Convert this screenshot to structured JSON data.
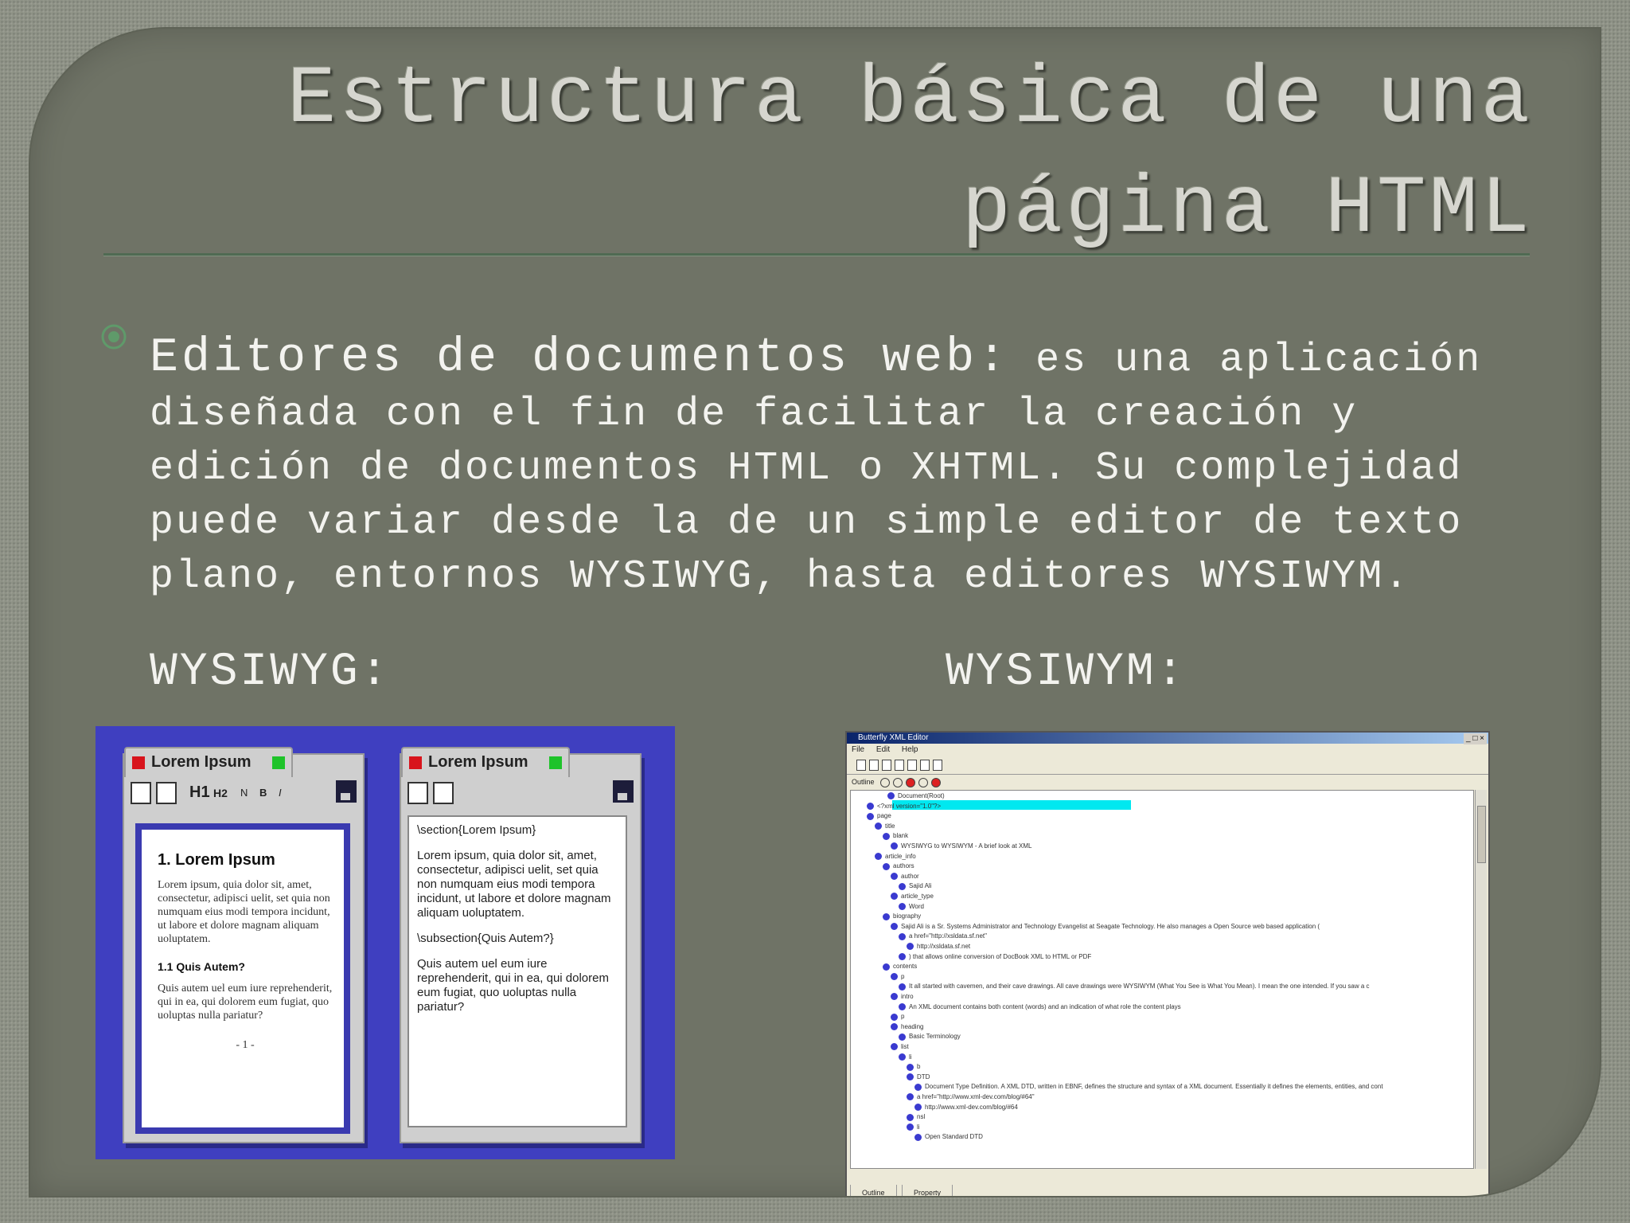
{
  "slide": {
    "title_line1": "Estructura básica de una",
    "title_line2": "página HTML",
    "body_lead": "Editores de documentos web:",
    "body_rest": " es una aplicación diseñada con el fin de facilitar la creación y edición de documentos HTML o XHTML. Su complejidad puede variar desde la de un simple editor de texto plano, entornos WYSIWYG, hasta editores WYSIWYM.",
    "label_wysiwyg": "WYSIWYG:",
    "label_wysiwym": "WYSIWYM:"
  },
  "wysiwyg_image": {
    "left_window": {
      "tab_title": "Lorem Ipsum",
      "toolbar": [
        "H1",
        "H2",
        "N",
        "B",
        "I"
      ],
      "heading": "1. Lorem Ipsum",
      "para1": "Lorem ipsum, quia dolor sit, amet, consectetur, adipisci uelit, set quia non numquam eius modi tempora incidunt, ut labore et dolore magnam aliquam uoluptatem.",
      "subheading": "1.1 Quis Autem?",
      "para2": "Quis autem uel eum iure reprehenderit, qui in ea, qui dolorem eum fugiat, quo uoluptas nulla pariatur?",
      "page_number": "- 1 -"
    },
    "right_window": {
      "tab_title": "Lorem Ipsum",
      "line1": "\\section{Lorem Ipsum}",
      "para1": "Lorem ipsum, quia dolor sit, amet, consectetur, adipisci uelit, set quia non numquam eius modi tempora incidunt, ut labore et dolore magnam aliquam uoluptatem.",
      "line2": "\\subsection{Quis Autem?}",
      "para2": "Quis autem uel eum iure reprehenderit, qui in ea, qui dolorem eum fugiat, quo uoluptas nulla pariatur?"
    }
  },
  "wysiwym_image": {
    "window_title": "Butterfly XML Editor",
    "window_controls": "_ □ ×",
    "menu": [
      "File",
      "Edit",
      "Help"
    ],
    "outline_label": "Outline",
    "tree_nodes": [
      "Document(Root)",
      "<?xml version=\"1.0\"?>",
      "page",
      "title",
      "blank",
      "WYSIWYG to WYSIWYM - A brief look at XML",
      "article_info",
      "authors",
      "author",
      "Sajid Ali",
      "article_type",
      "Word",
      "biography",
      "Sajid Ali is a Sr. Systems Administrator and Technology Evangelist at Seagate Technology. He also manages a Open Source web based application (",
      "a href=\"http://xsldata.sf.net\"",
      "http://xsldata.sf.net",
      ") that allows online conversion of DocBook XML to HTML or PDF",
      "contents",
      "p",
      "It all started with cavemen, and their cave drawings. All cave drawings were WYSIWYM (What You See is What You Mean). I mean the one intended. If you saw a c",
      "intro",
      "An XML document contains both content (words) and an indication of what role the content plays",
      "p",
      "heading",
      "Basic Terminology",
      "list",
      "li",
      "b",
      "DTD",
      "Document Type Definition. A XML DTD, written in EBNF, defines the structure and syntax of a XML document. Essentially it defines the elements, entities, and cont",
      "a href=\"http://www.xml-dev.com/blog/#64\"",
      "http://www.xml-dev.com/blog/#64",
      "nsl",
      "li",
      "Open Standard DTD"
    ],
    "bottom_tabs": [
      "Outline",
      "Property"
    ]
  }
}
